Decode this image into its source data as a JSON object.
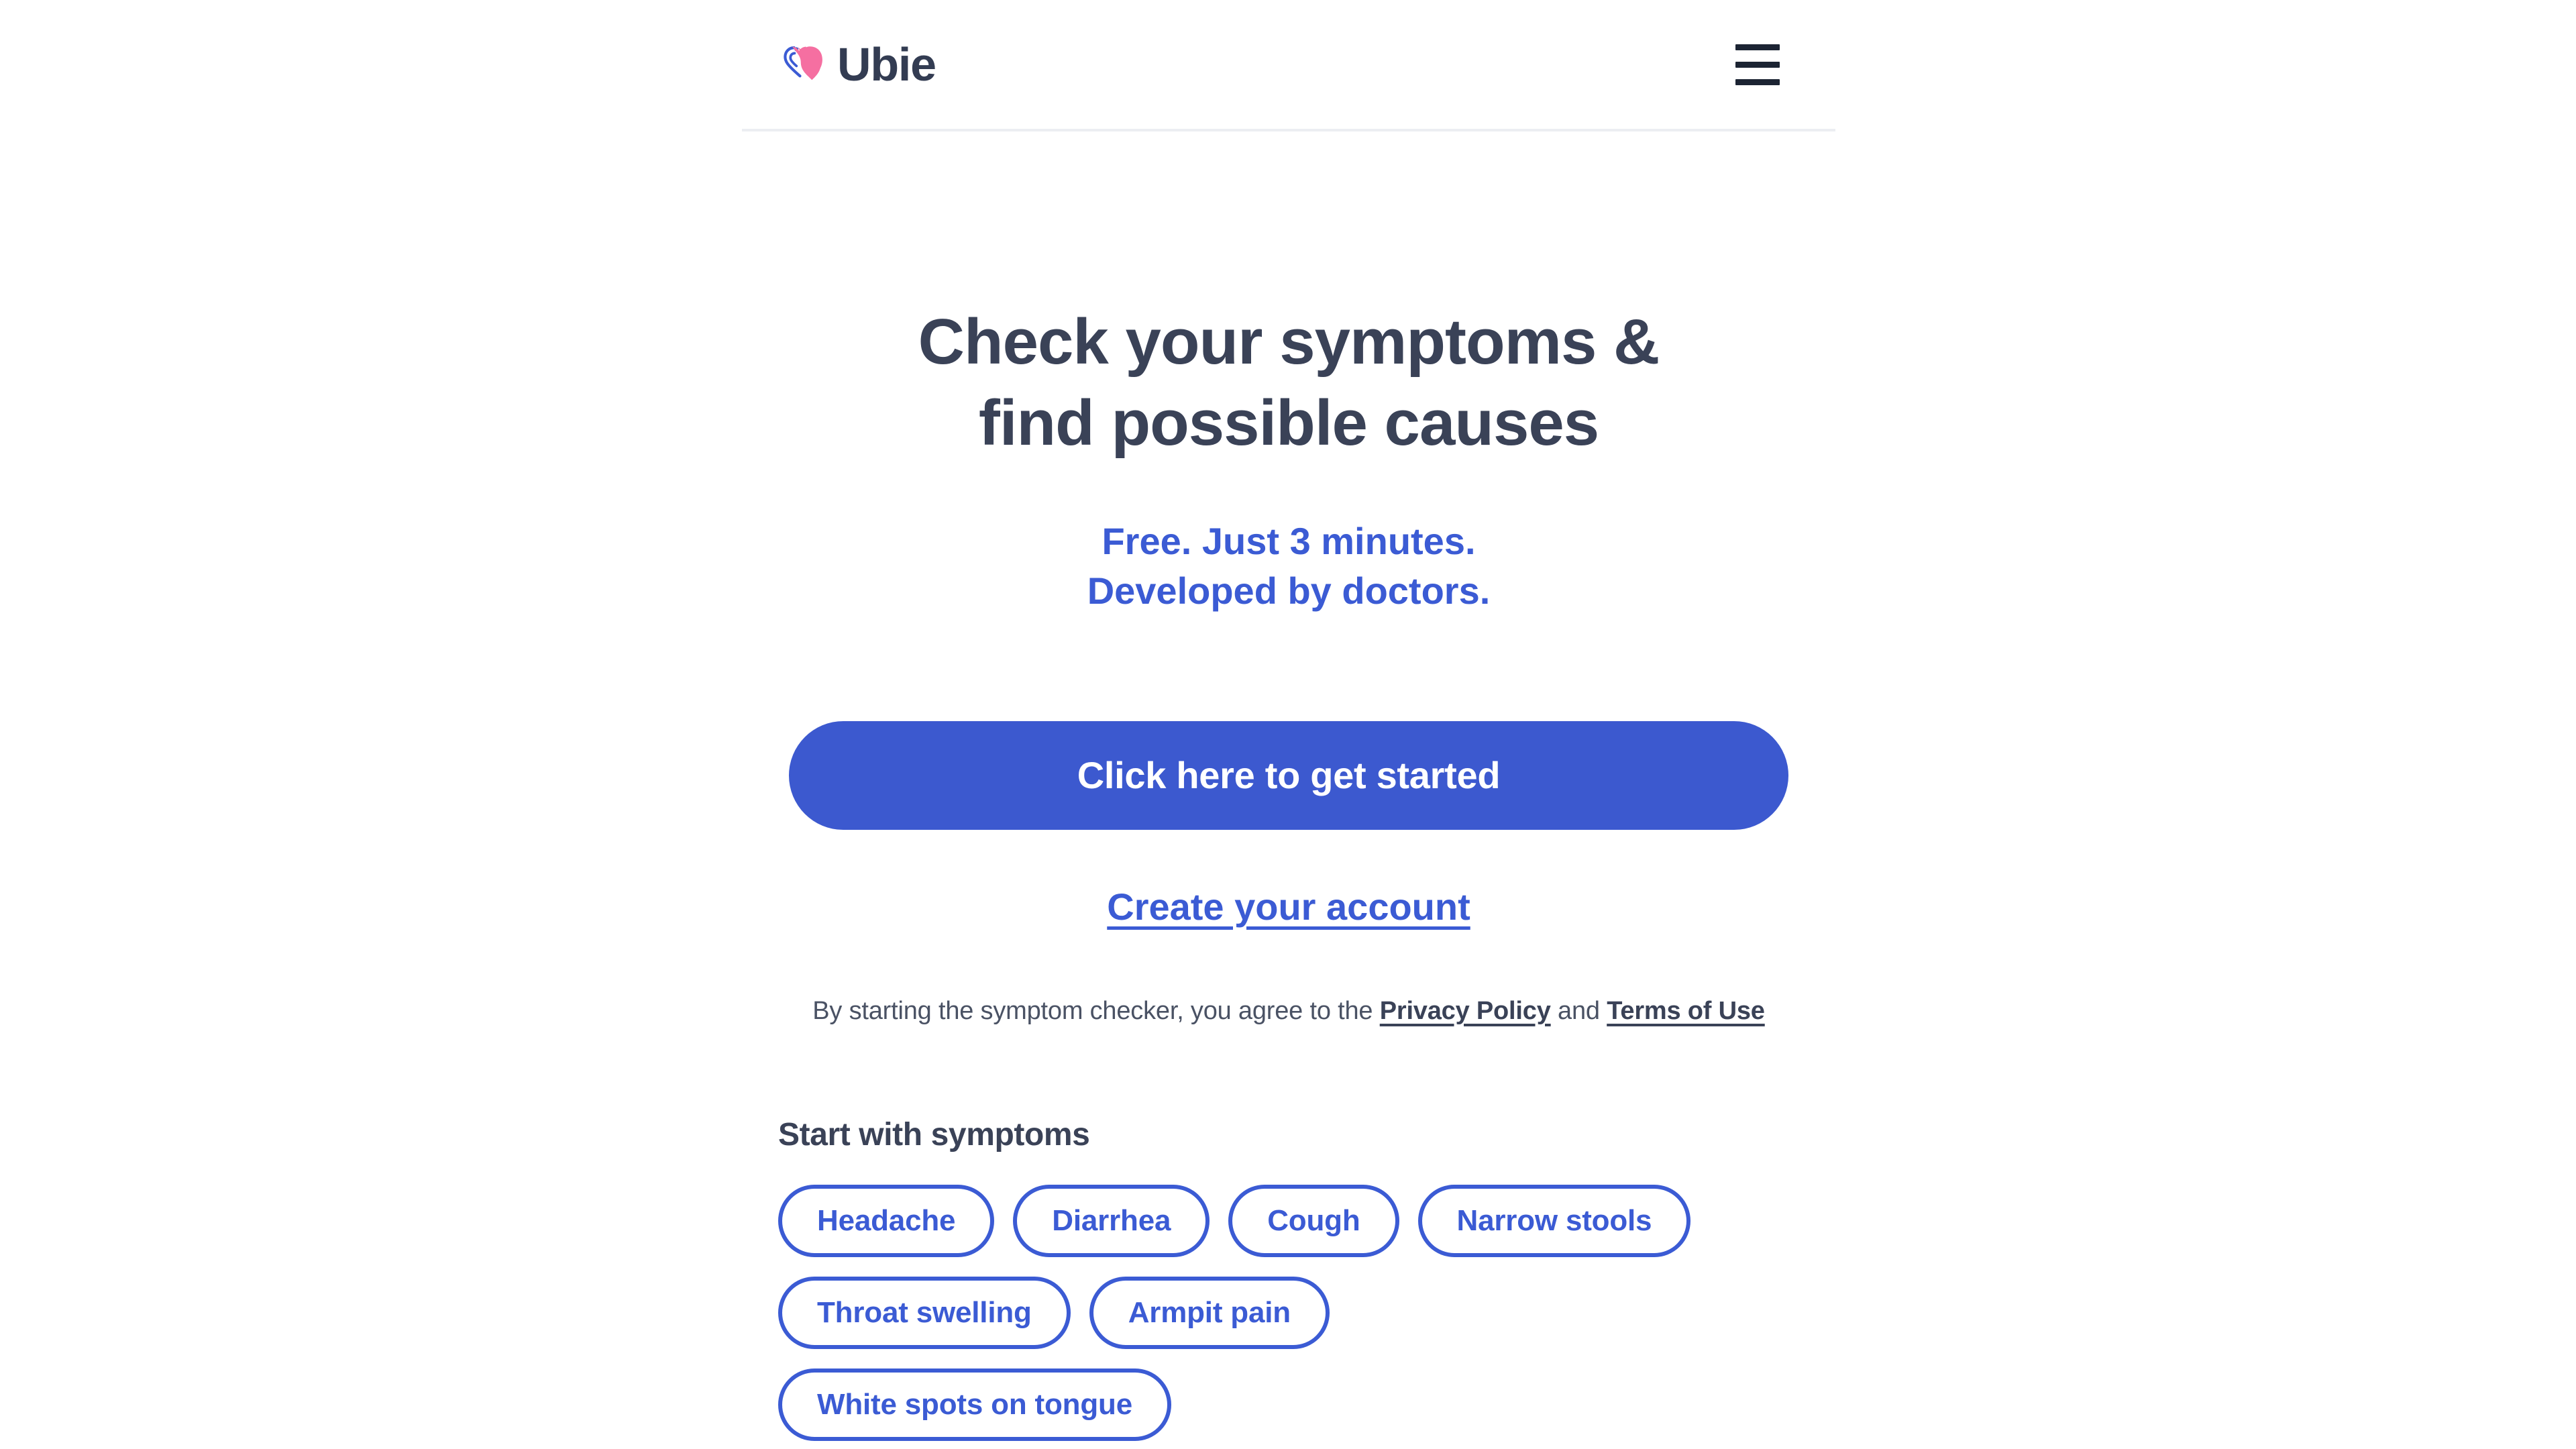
{
  "header": {
    "brand_name": "Ubie",
    "logo_icon": "ubie-heart-logo",
    "menu_icon": "hamburger-menu-icon",
    "colors": {
      "heart_pink": "#f56fa1",
      "heart_blue": "#3b5bd4",
      "brand_text": "#333c52",
      "divider": "#eceef2"
    }
  },
  "hero": {
    "title_line1": "Check your symptoms &",
    "title_line2": "find possible causes",
    "subtitle_line1": "Free. Just 3 minutes.",
    "subtitle_line2": "Developed by doctors.",
    "title_color": "#3a4257",
    "subtitle_color": "#3b5bd4"
  },
  "cta": {
    "primary_label": "Click here to get started",
    "primary_bg": "#3c59cf",
    "secondary_label": "Create your account",
    "secondary_color": "#3b5bd4"
  },
  "legal": {
    "prefix": "By starting the symptom checker, you agree to the ",
    "privacy_label": "Privacy Policy",
    "conjunction": " and ",
    "terms_label": "Terms of Use"
  },
  "symptoms": {
    "heading": "Start with symptoms",
    "chips": [
      {
        "label": "Headache"
      },
      {
        "label": "Diarrhea"
      },
      {
        "label": "Cough"
      },
      {
        "label": "Narrow stools"
      },
      {
        "label": "Throat swelling"
      },
      {
        "label": "Armpit pain"
      },
      {
        "label": "White spots on tongue"
      }
    ],
    "chip_color": "#3b5bd4"
  }
}
